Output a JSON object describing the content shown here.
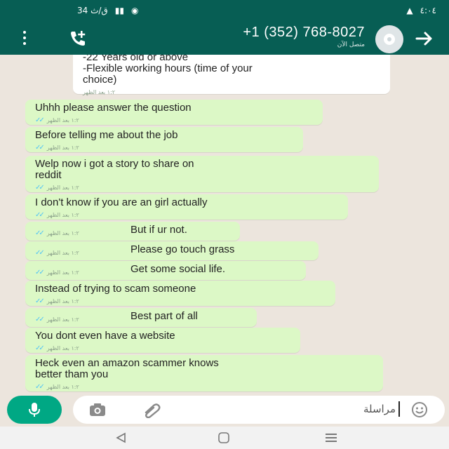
{
  "status_bar": {
    "left_text": "34 ق/ث",
    "right_text": "٤:٠٤"
  },
  "header": {
    "contact_name": "+1 (352) 768-8027",
    "contact_status": "متصل الآن"
  },
  "messages": [
    {
      "text": "-22 Years old or above\n-Flexible working hours (time of your\nchoice)",
      "time": "١:٢ بعد الظهر",
      "type": "incoming"
    },
    {
      "text": "Uhhh please answer the question",
      "time": "١:٢ بعد الظهر",
      "type": "outgoing"
    },
    {
      "text": "Before telling me about the job",
      "time": "١:٢ بعد الظهر",
      "type": "outgoing"
    },
    {
      "text": "Welp now i got a story to share on\nreddit",
      "time": "١:٢ بعد الظهر",
      "type": "outgoing"
    },
    {
      "text": "I don't know if you are an girl actually",
      "time": "١:٢ بعد الظهر",
      "type": "outgoing"
    },
    {
      "text": "But if ur not.",
      "time": "١:٢ بعد الظهر",
      "type": "outgoing"
    },
    {
      "text": "Please go touch grass",
      "time": "١:٢ بعد الظهر",
      "type": "outgoing"
    },
    {
      "text": "Get some social life.",
      "time": "١:٢ بعد الظهر",
      "type": "outgoing"
    },
    {
      "text": "Instead of trying to scam someone",
      "time": "١:٢ بعد الظهر",
      "type": "outgoing"
    },
    {
      "text": "Best part of all",
      "time": "١:٢ بعد الظهر",
      "type": "outgoing"
    },
    {
      "text": "You dont even have a website",
      "time": "١:٢ بعد الظهر",
      "type": "outgoing"
    },
    {
      "text": "Heck even an amazon scammer knows\nbetter tham you",
      "time": "١:٢ بعد الظهر",
      "type": "outgoing"
    }
  ],
  "composer": {
    "placeholder": "مراسلة"
  },
  "colors": {
    "header": "#075e54",
    "outgoing_bubble": "#dcf8c6",
    "chat_background": "#ece5dd",
    "mic_button": "#00a884"
  },
  "icons": [
    "menu-icon",
    "call-add-icon",
    "avatar",
    "back-arrow-icon",
    "mic-icon",
    "camera-icon",
    "attach-icon",
    "emoji-icon",
    "double-check-icon"
  ]
}
